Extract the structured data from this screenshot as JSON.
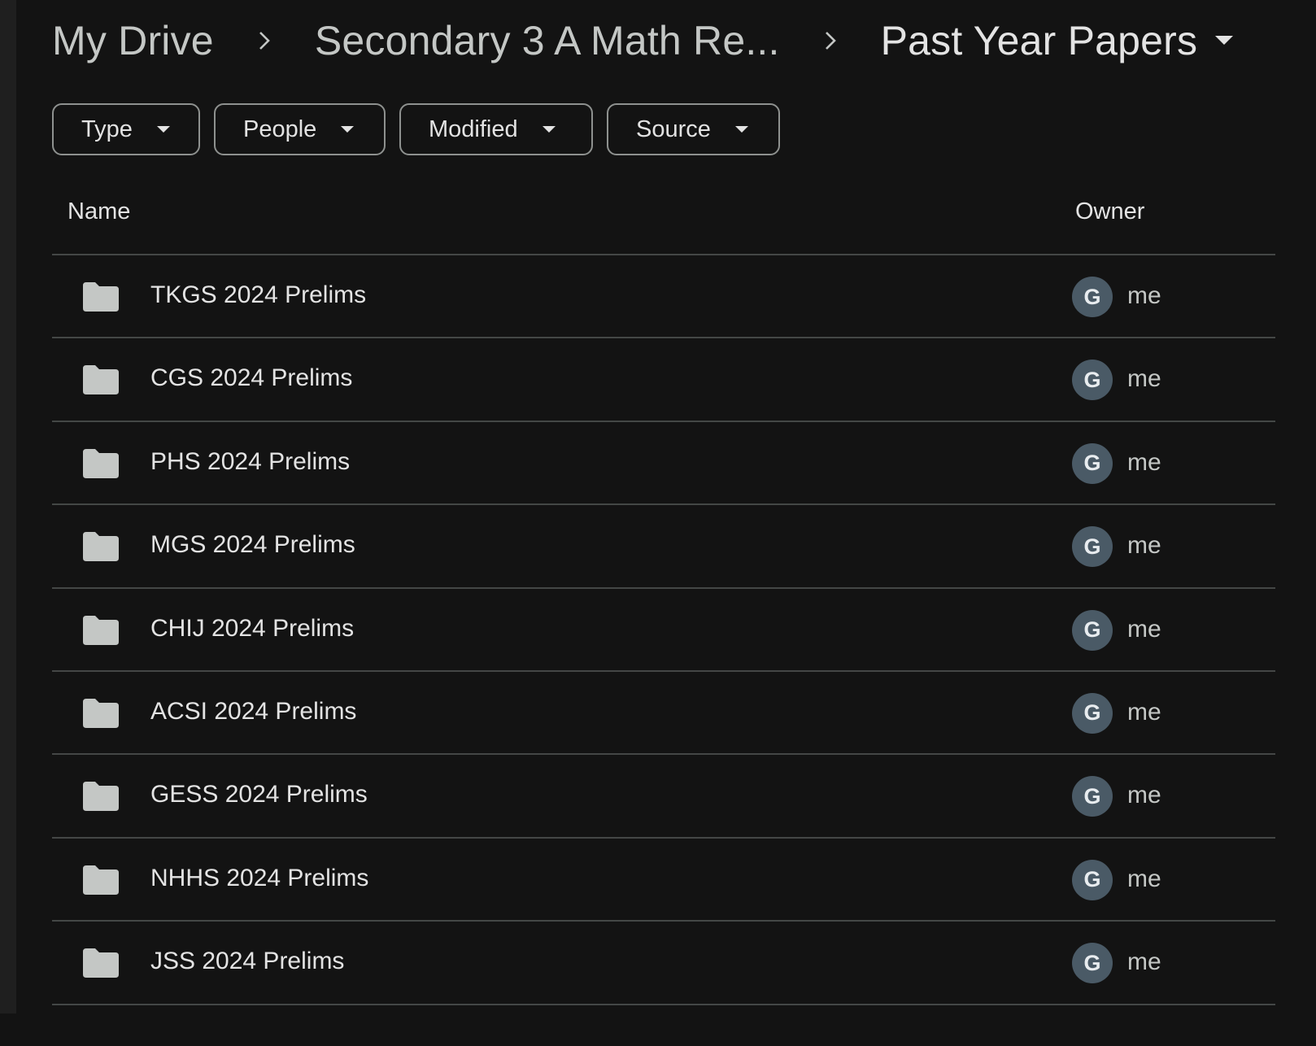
{
  "breadcrumb": {
    "items": [
      {
        "label": "My Drive"
      },
      {
        "label": "Secondary 3 A Math Re..."
      },
      {
        "label": "Past Year Papers"
      }
    ]
  },
  "filters": [
    {
      "label": "Type"
    },
    {
      "label": "People"
    },
    {
      "label": "Modified"
    },
    {
      "label": "Source"
    }
  ],
  "table": {
    "columns": {
      "name": "Name",
      "owner": "Owner"
    },
    "rows": [
      {
        "name": "TKGS 2024 Prelims",
        "owner": "me",
        "avatar_initial": "G",
        "icon": "folder-icon"
      },
      {
        "name": "CGS 2024 Prelims",
        "owner": "me",
        "avatar_initial": "G",
        "icon": "folder-icon"
      },
      {
        "name": "PHS 2024 Prelims",
        "owner": "me",
        "avatar_initial": "G",
        "icon": "folder-icon"
      },
      {
        "name": "MGS 2024 Prelims",
        "owner": "me",
        "avatar_initial": "G",
        "icon": "folder-icon"
      },
      {
        "name": "CHIJ 2024 Prelims",
        "owner": "me",
        "avatar_initial": "G",
        "icon": "folder-icon"
      },
      {
        "name": "ACSI 2024 Prelims",
        "owner": "me",
        "avatar_initial": "G",
        "icon": "folder-icon"
      },
      {
        "name": "GESS 2024 Prelims",
        "owner": "me",
        "avatar_initial": "G",
        "icon": "folder-icon"
      },
      {
        "name": "NHHS 2024 Prelims",
        "owner": "me",
        "avatar_initial": "G",
        "icon": "folder-icon"
      },
      {
        "name": "JSS 2024 Prelims",
        "owner": "me",
        "avatar_initial": "G",
        "icon": "folder-icon"
      }
    ]
  },
  "colors": {
    "background": "#131313",
    "text": "#e3e3e3",
    "muted_text": "#c4c7c5",
    "divider": "#444746",
    "chip_border": "#8e918f",
    "folder": "#c4c7c5",
    "avatar_bg": "#4a5a66"
  }
}
